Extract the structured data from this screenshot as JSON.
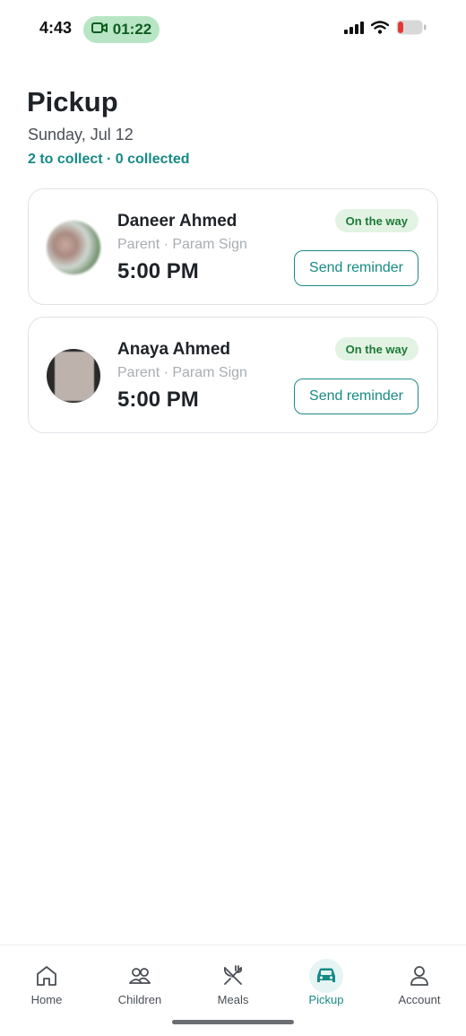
{
  "status_bar": {
    "time": "4:43",
    "call_timer": "01:22",
    "icons": [
      "video-camera-icon",
      "signal-icon",
      "wifi-icon",
      "battery-low-icon"
    ]
  },
  "header": {
    "title": "Pickup",
    "date": "Sunday, Jul 12",
    "summary": "2 to collect · 0 collected"
  },
  "pickups": [
    {
      "name": "Daneer Ahmed",
      "meta": "Parent · Param Sign",
      "time": "5:00 PM",
      "status": "On the way",
      "action_label": "Send reminder"
    },
    {
      "name": "Anaya Ahmed",
      "meta": "Parent · Param Sign",
      "time": "5:00 PM",
      "status": "On the way",
      "action_label": "Send reminder"
    }
  ],
  "nav": {
    "items": [
      {
        "label": "Home",
        "icon": "home-icon",
        "active": false
      },
      {
        "label": "Children",
        "icon": "children-icon",
        "active": false
      },
      {
        "label": "Meals",
        "icon": "fork-knife-icon",
        "active": false
      },
      {
        "label": "Pickup",
        "icon": "car-icon",
        "active": true
      },
      {
        "label": "Account",
        "icon": "person-icon",
        "active": false
      }
    ]
  },
  "colors": {
    "accent": "#178a86",
    "badge_bg": "#e2f3e4",
    "badge_text": "#1c7a33",
    "call_pill": "#b8e6c4",
    "battery_low": "#e53935"
  }
}
